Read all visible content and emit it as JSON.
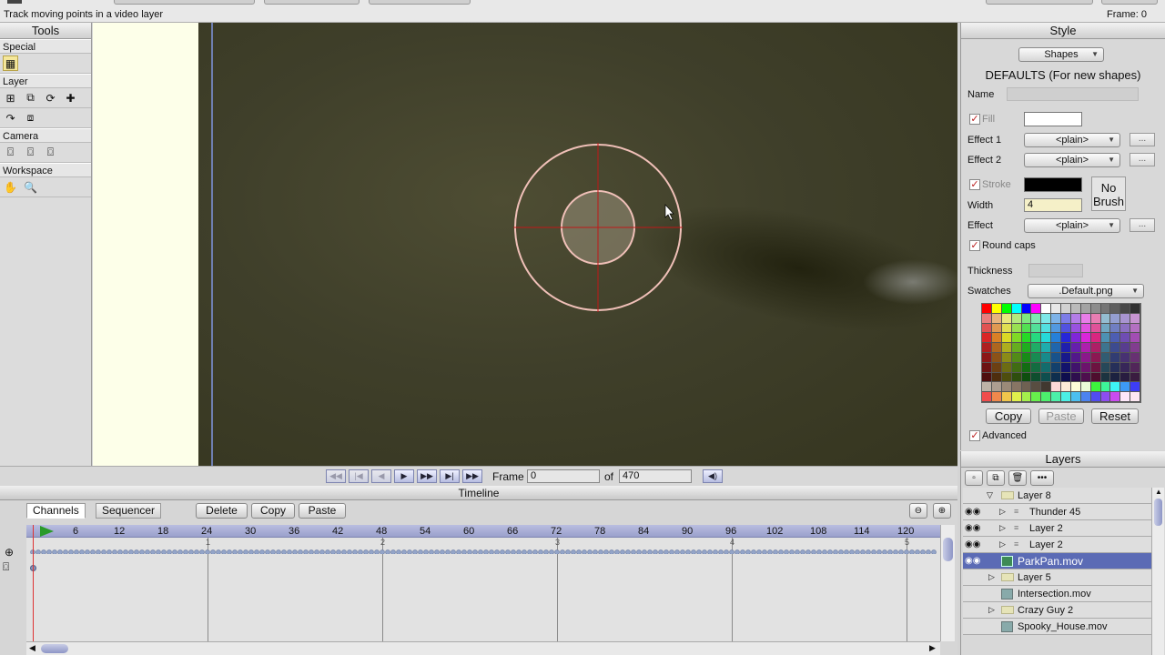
{
  "status_bar": {
    "hint": "Track moving points in a video layer",
    "frame_label": "Frame: 0"
  },
  "tools": {
    "title": "Tools",
    "sections": [
      "Special",
      "Layer",
      "Camera",
      "Workspace"
    ]
  },
  "transport": {
    "frame_label": "Frame",
    "frame_value": "0",
    "of_label": "of",
    "total_frames": "470"
  },
  "timeline": {
    "title": "Timeline",
    "tabs": [
      "Channels",
      "Sequencer"
    ],
    "buttons": [
      "Delete",
      "Copy",
      "Paste"
    ],
    "ruler_ticks": [
      "6",
      "12",
      "18",
      "24",
      "30",
      "36",
      "42",
      "48",
      "54",
      "60",
      "66",
      "72",
      "78",
      "84",
      "90",
      "96",
      "102",
      "108",
      "114",
      "120"
    ],
    "second_marks": [
      "1",
      "2",
      "3",
      "4",
      "5"
    ]
  },
  "style": {
    "title": "Style",
    "mode_dropdown": "Shapes",
    "defaults_heading": "DEFAULTS (For new shapes)",
    "name_label": "Name",
    "fill_label": "Fill",
    "effect1_label": "Effect 1",
    "effect1_value": "<plain>",
    "effect2_label": "Effect 2",
    "effect2_value": "<plain>",
    "stroke_label": "Stroke",
    "no_brush_line1": "No",
    "no_brush_line2": "Brush",
    "width_label": "Width",
    "width_value": "4",
    "effect_label": "Effect",
    "effect_value": "<plain>",
    "round_caps_label": "Round caps",
    "thickness_label": "Thickness",
    "swatches_label": "Swatches",
    "swatches_value": ".Default.png",
    "copy_label": "Copy",
    "paste_label": "Paste",
    "reset_label": "Reset",
    "advanced_label": "Advanced",
    "ellipsis": "...",
    "colors": {
      "fill": "#ffffff",
      "stroke": "#000000"
    }
  },
  "layers": {
    "title": "Layers",
    "items": [
      {
        "name": "Layer 8",
        "indent": 0
      },
      {
        "name": "Thunder 45",
        "indent": 1
      },
      {
        "name": "Layer 2",
        "indent": 1
      },
      {
        "name": "Layer 2",
        "indent": 1
      },
      {
        "name": "ParkPan.mov",
        "indent": 0
      },
      {
        "name": "Layer 5",
        "indent": 0
      },
      {
        "name": "Intersection.mov",
        "indent": 0
      },
      {
        "name": "Crazy Guy 2",
        "indent": 0
      },
      {
        "name": "Spooky_House.mov",
        "indent": 0
      }
    ]
  }
}
